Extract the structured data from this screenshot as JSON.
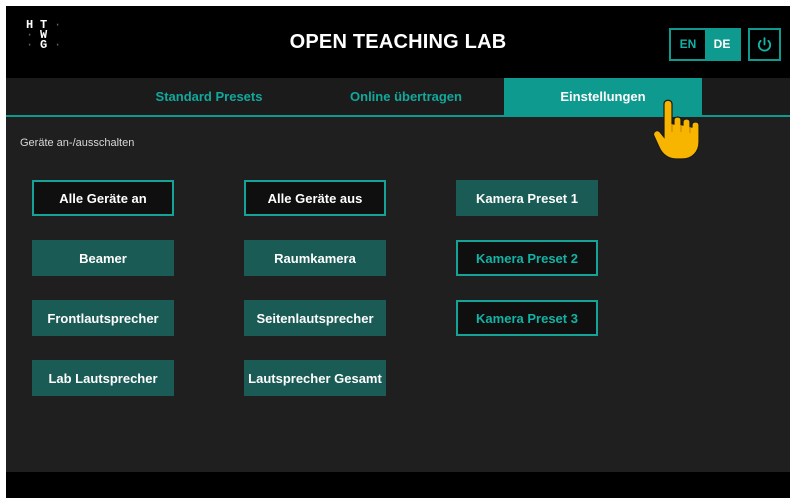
{
  "header": {
    "logo_letters": [
      "H",
      "T",
      "W",
      "G"
    ],
    "title": "OPEN TEACHING LAB",
    "lang_options": [
      {
        "label": "EN",
        "active": false
      },
      {
        "label": "DE",
        "active": true
      }
    ],
    "power_icon": "power-icon"
  },
  "tabs": [
    {
      "label": "Standard Presets",
      "active": false
    },
    {
      "label": "Online übertragen",
      "active": false
    },
    {
      "label": "Einstellungen",
      "active": true
    }
  ],
  "main": {
    "section_label": "Geräte an-/ausschalten",
    "buttons": [
      {
        "label": "Alle Geräte an",
        "style": "outline"
      },
      {
        "label": "Alle Geräte aus",
        "style": "outline"
      },
      {
        "label": "Kamera Preset 1",
        "style": "fill"
      },
      {
        "label": "Beamer",
        "style": "fill"
      },
      {
        "label": "Raumkamera",
        "style": "fill"
      },
      {
        "label": "Kamera Preset 2",
        "style": "outline"
      },
      {
        "label": "Frontlautsprecher",
        "style": "fill"
      },
      {
        "label": "Seitenlautsprecher",
        "style": "fill"
      },
      {
        "label": "Kamera Preset 3",
        "style": "outline"
      },
      {
        "label": "Lab Lautsprecher",
        "style": "fill"
      },
      {
        "label": "Lautsprecher Gesamt",
        "style": "fill"
      }
    ]
  },
  "cursor_icon": "pointing-hand-icon",
  "colors": {
    "accent": "#0f9a90",
    "button_fill": "#1a5b56",
    "background": "#1f1f1f",
    "header": "#000000"
  }
}
